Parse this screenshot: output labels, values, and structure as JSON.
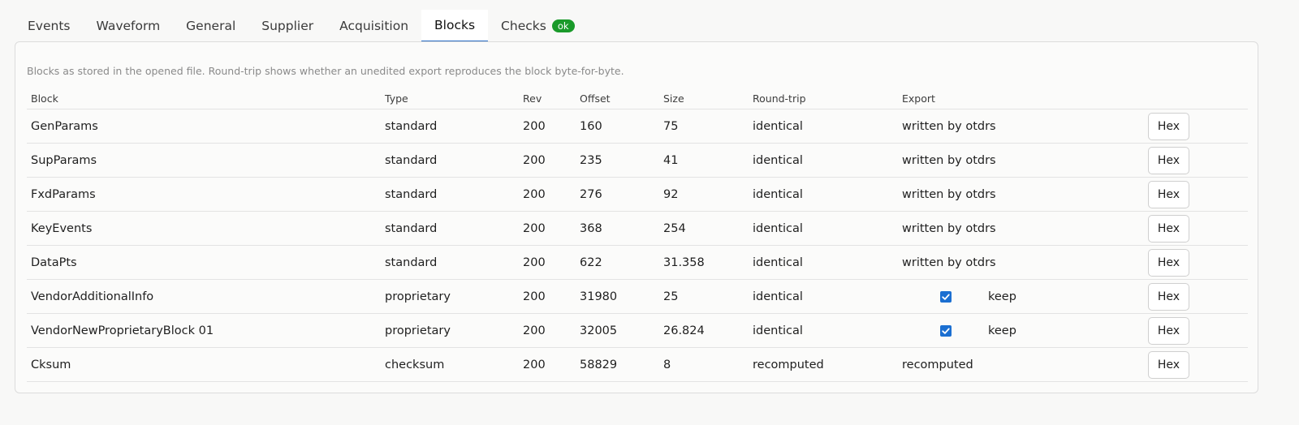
{
  "tabs": [
    {
      "label": "Events",
      "active": false
    },
    {
      "label": "Waveform",
      "active": false
    },
    {
      "label": "General",
      "active": false
    },
    {
      "label": "Supplier",
      "active": false
    },
    {
      "label": "Acquisition",
      "active": false
    },
    {
      "label": "Blocks",
      "active": true
    },
    {
      "label": "Checks",
      "active": false,
      "badge": "ok"
    }
  ],
  "colors": {
    "accent": "#2a6ec6",
    "badge_ok": "#1a9a2a",
    "checkbox": "#1b6fd1"
  },
  "blocks": {
    "description": "Blocks as stored in the opened file. Round-trip shows whether an unedited export reproduces the block byte-for-byte.",
    "columns": [
      "Block",
      "Type",
      "Rev",
      "Offset",
      "Size",
      "Round-trip",
      "Export"
    ],
    "hex_label": "Hex",
    "rows": [
      {
        "block": "GenParams",
        "type": "standard",
        "rev": "200",
        "offset": "160",
        "size": "75",
        "roundtrip": "identical",
        "export": "written by otdrs"
      },
      {
        "block": "SupParams",
        "type": "standard",
        "rev": "200",
        "offset": "235",
        "size": "41",
        "roundtrip": "identical",
        "export": "written by otdrs"
      },
      {
        "block": "FxdParams",
        "type": "standard",
        "rev": "200",
        "offset": "276",
        "size": "92",
        "roundtrip": "identical",
        "export": "written by otdrs"
      },
      {
        "block": "KeyEvents",
        "type": "standard",
        "rev": "200",
        "offset": "368",
        "size": "254",
        "roundtrip": "identical",
        "export": "written by otdrs"
      },
      {
        "block": "DataPts",
        "type": "standard",
        "rev": "200",
        "offset": "622",
        "size": "31.358",
        "roundtrip": "identical",
        "export": "written by otdrs"
      },
      {
        "block": "VendorAdditionalInfo",
        "type": "proprietary",
        "rev": "200",
        "offset": "31980",
        "size": "25",
        "roundtrip": "identical",
        "export_checkbox": true,
        "export": "keep"
      },
      {
        "block": "VendorNewProprietaryBlock 01",
        "type": "proprietary",
        "rev": "200",
        "offset": "32005",
        "size": "26.824",
        "roundtrip": "identical",
        "export_checkbox": true,
        "export": "keep"
      },
      {
        "block": "Cksum",
        "type": "checksum",
        "rev": "200",
        "offset": "58829",
        "size": "8",
        "roundtrip": "recomputed",
        "export": "recomputed"
      }
    ]
  }
}
